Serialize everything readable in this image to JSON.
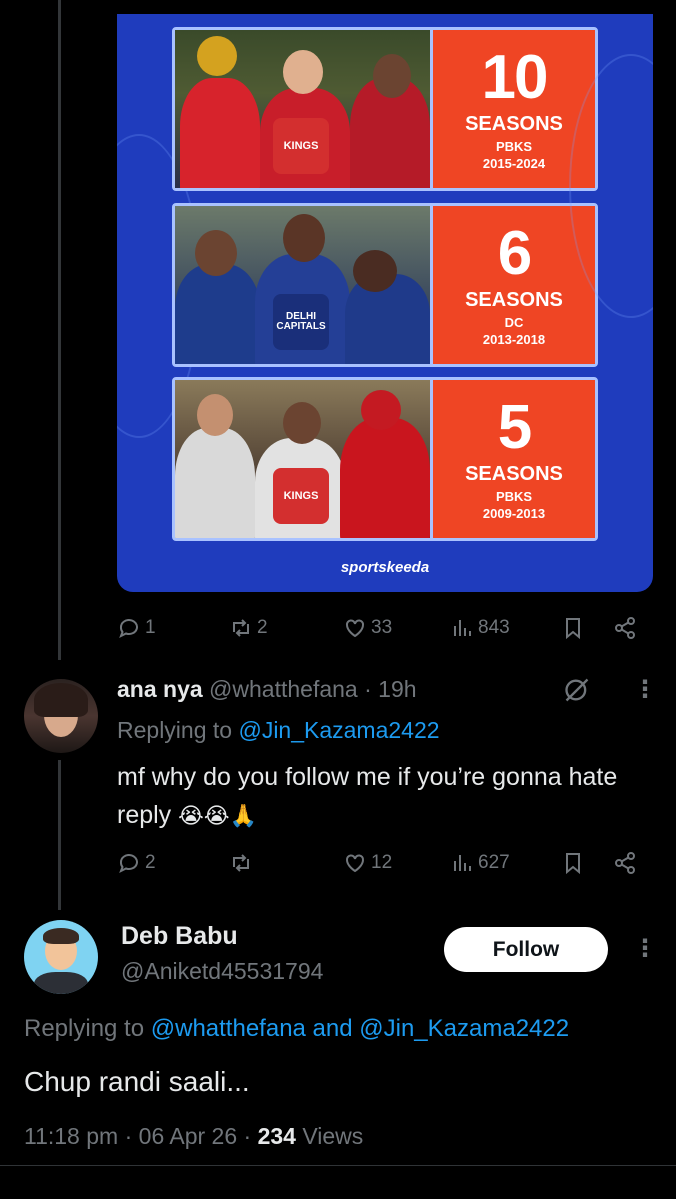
{
  "graphic": {
    "panels": [
      {
        "number": "10",
        "seasons": "SEASONS",
        "team": "PBKS",
        "years": "2015-2024",
        "logo": "KINGS"
      },
      {
        "number": "6",
        "seasons": "SEASONS",
        "team": "DC",
        "years": "2013-2018",
        "logo": "DELHI CAPITALS"
      },
      {
        "number": "5",
        "seasons": "SEASONS",
        "team": "PBKS",
        "years": "2009-2013",
        "logo": "KINGS"
      }
    ],
    "brand": "sportskeeda",
    "colors": {
      "background": "#1f3cbd",
      "stat": "#ef4524",
      "border": "#a9c2ff"
    }
  },
  "parent_actions": {
    "replies": "1",
    "reposts": "2",
    "likes": "33",
    "views": "843"
  },
  "reply": {
    "name": "ana nya",
    "handle": "@whatthefana",
    "time": "· 19h",
    "replying_prefix": "Replying to",
    "replying_to": "@Jin_Kazama2422",
    "text": "mf why do you follow me if you’re gonna hate reply",
    "emojis": "😭😭🙏",
    "actions": {
      "replies": "2",
      "reposts": "",
      "likes": "12",
      "views": "627"
    }
  },
  "main_tweet": {
    "name": "Deb Babu",
    "handle": "@Aniketd45531794",
    "follow_label": "Follow",
    "replying_prefix": "Replying to",
    "replying_to": "@whatthefana and @Jin_Kazama2422",
    "text": "Chup randi saali...",
    "time": "11:18 pm",
    "date": "06 Apr 26",
    "views_count": "234",
    "views_label": "Views"
  },
  "colors": {
    "link": "#1d9bf0",
    "muted": "#71767b",
    "text": "#e7e9ea"
  }
}
